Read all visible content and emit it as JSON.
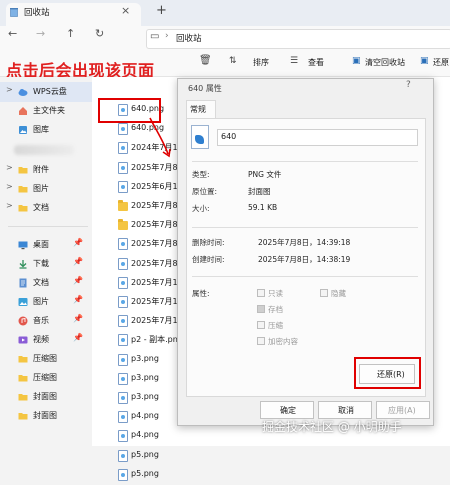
{
  "window": {
    "tab_title": "回收站",
    "tab_close": "×",
    "new_tab": "+"
  },
  "nav": {
    "back": "←",
    "forward": "→",
    "up": "↑",
    "refresh": "↻",
    "monitor": "▭",
    "sep": "›",
    "address": "回收站"
  },
  "toolbar": {
    "sort_label": "排序",
    "view_label": "查看",
    "empty_label": "清空回收站",
    "restore_label": "还原"
  },
  "annotation": {
    "text": "点击后会出现该页面"
  },
  "sidebar": {
    "items": [
      {
        "label": "WPS云盘",
        "icon": "cloud-icon"
      },
      {
        "label": "主文件夹",
        "icon": "home-icon"
      },
      {
        "label": "图库",
        "icon": "gallery-icon"
      },
      {
        "label": "附件",
        "icon": "folder-icon"
      },
      {
        "label": "图片",
        "icon": "folder-icon"
      },
      {
        "label": "文档",
        "icon": "folder-icon"
      },
      {
        "label": "桌面",
        "icon": "desktop-icon"
      },
      {
        "label": "下载",
        "icon": "download-icon"
      },
      {
        "label": "文档",
        "icon": "documents-icon"
      },
      {
        "label": "图片",
        "icon": "pictures-icon"
      },
      {
        "label": "音乐",
        "icon": "music-icon"
      },
      {
        "label": "视频",
        "icon": "video-icon"
      },
      {
        "label": "压缩图",
        "icon": "folder-icon"
      },
      {
        "label": "压缩图",
        "icon": "folder-icon"
      },
      {
        "label": "封面图",
        "icon": "folder-icon"
      },
      {
        "label": "封面图",
        "icon": "folder-icon"
      }
    ],
    "pin": "📌",
    "expand": ">"
  },
  "files": [
    {
      "name": "640.png",
      "type": "png"
    },
    {
      "name": "640.png",
      "type": "png"
    },
    {
      "name": "2024年7月1日",
      "type": "png"
    },
    {
      "name": "2025年7月8日",
      "type": "png"
    },
    {
      "name": "2025年6月18日",
      "type": "png"
    },
    {
      "name": "2025年7月8日",
      "type": "folder"
    },
    {
      "name": "2025年7月8日",
      "type": "folder"
    },
    {
      "name": "2025年7月8日",
      "type": "png"
    },
    {
      "name": "2025年7月8日",
      "type": "png"
    },
    {
      "name": "2025年7月14日",
      "type": "png"
    },
    {
      "name": "2025年7月14日",
      "type": "png"
    },
    {
      "name": "2025年7月14日",
      "type": "png"
    },
    {
      "name": "p2 - 副本.png",
      "type": "png"
    },
    {
      "name": "p3.png",
      "type": "png"
    },
    {
      "name": "p3.png",
      "type": "png"
    },
    {
      "name": "p3.png",
      "type": "png"
    },
    {
      "name": "p4.png",
      "type": "png"
    },
    {
      "name": "p4.png",
      "type": "png"
    },
    {
      "name": "p5.png",
      "type": "png"
    },
    {
      "name": "p5.png",
      "type": "png"
    }
  ],
  "dialog": {
    "title": "640 属性",
    "help": "?",
    "tab_general": "常规",
    "filename": "640",
    "type_label": "类型:",
    "type_value": "PNG 文件",
    "location_label": "原位置:",
    "location_value": "封面图",
    "size_label": "大小:",
    "size_value": "59.1 KB",
    "deleted_label": "删除时间:",
    "deleted_value": "2025年7月8日，14:39:18",
    "created_label": "创建时间:",
    "created_value": "2025年7月8日，14:38:19",
    "attrs_label": "属性:",
    "attr_readonly": "只读",
    "attr_hidden": "隐藏",
    "attr_archive": "存档",
    "attr_compressed": "压缩",
    "attr_encrypted": "加密内容",
    "restore_button": "还原(R)",
    "ok_button": "确定",
    "cancel_button": "取消",
    "apply_button": "应用(A)"
  },
  "watermark": "掘金技术社区 @ 小明助手"
}
